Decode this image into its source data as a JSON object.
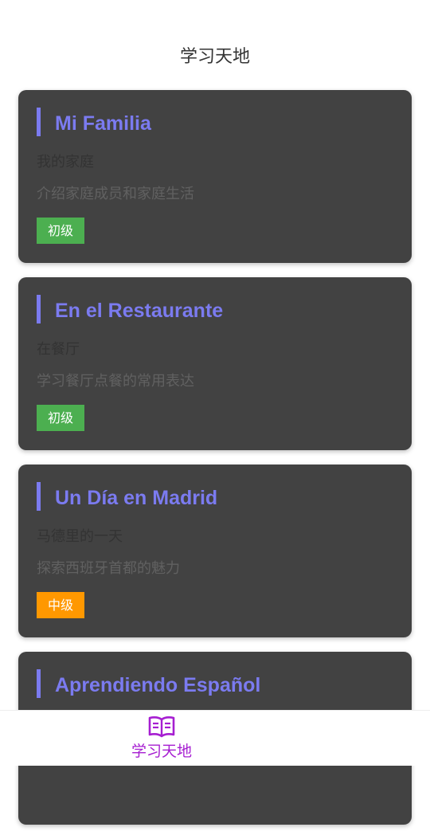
{
  "header": {
    "title": "学习天地"
  },
  "lessons": [
    {
      "title": "Mi Familia",
      "subtitle": "我的家庭",
      "description": "介绍家庭成员和家庭生活",
      "level": "初级",
      "level_color": "#4caf50"
    },
    {
      "title": "En el Restaurante",
      "subtitle": "在餐厅",
      "description": "学习餐厅点餐的常用表达",
      "level": "初级",
      "level_color": "#4caf50"
    },
    {
      "title": "Un Día en Madrid",
      "subtitle": "马德里的一天",
      "description": "探索西班牙首都的魅力",
      "level": "中级",
      "level_color": "#ff9800"
    },
    {
      "title": "Aprendiendo Español",
      "subtitle": "",
      "description": "",
      "level": "",
      "level_color": ""
    }
  ],
  "tabbar": {
    "tabs": [
      {
        "label": "学习天地",
        "icon": "open-book-icon",
        "active": true
      }
    ]
  },
  "colors": {
    "accent": "#7b7bf0",
    "card_bg": "#424242",
    "tab_active": "#a61ed1"
  }
}
